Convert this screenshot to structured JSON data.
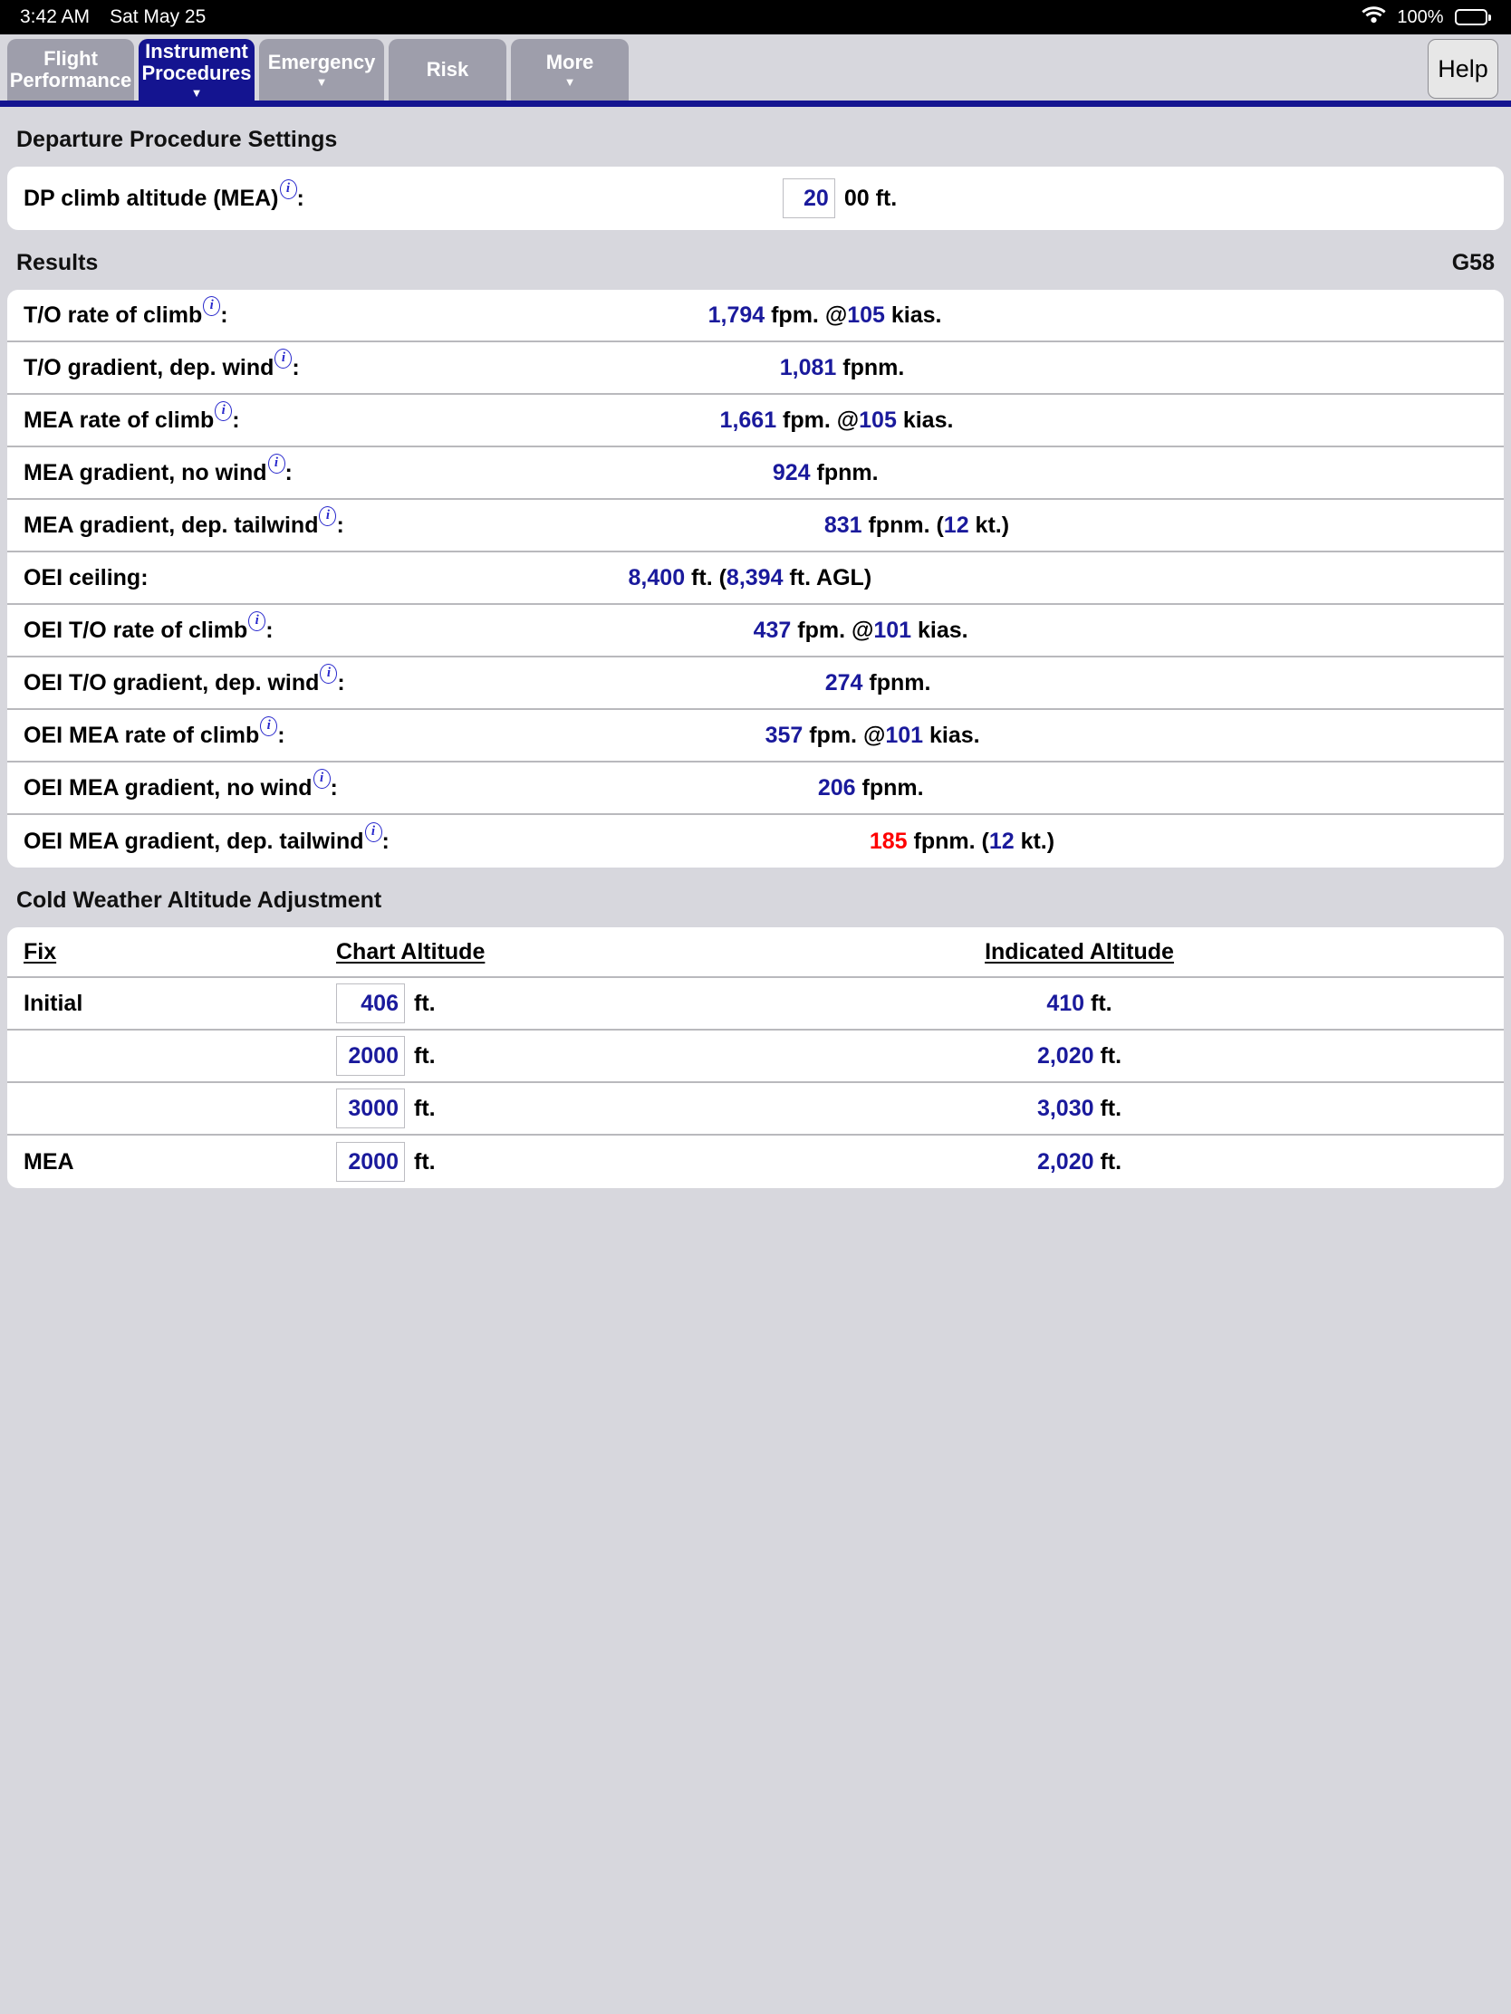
{
  "status_bar": {
    "time": "3:42 AM",
    "date": "Sat May 25",
    "battery_percent": "100%",
    "wifi_icon": "wifi-icon",
    "battery_icon": "battery-full-icon"
  },
  "tabs": [
    {
      "label": "Flight\nPerformance",
      "active": false,
      "has_caret": false,
      "name": "tab-flight-performance"
    },
    {
      "label": "Instrument\nProcedures",
      "active": true,
      "has_caret": true,
      "name": "tab-instrument-procedures"
    },
    {
      "label": "Emergency",
      "active": false,
      "has_caret": true,
      "name": "tab-emergency"
    },
    {
      "label": "Risk",
      "active": false,
      "has_caret": false,
      "name": "tab-risk"
    },
    {
      "label": "More",
      "active": false,
      "has_caret": true,
      "name": "tab-more"
    }
  ],
  "help_button": {
    "label": "Help"
  },
  "departure_settings": {
    "header": "Departure Procedure Settings",
    "dp_climb_altitude": {
      "label": "DP climb altitude (MEA)",
      "colon": ":",
      "value": "20",
      "suffix": "00 ft."
    }
  },
  "results": {
    "header": "Results",
    "aircraft": "G58",
    "rows": [
      {
        "label": "T/O rate of climb",
        "info": true,
        "value": "1,794",
        "unit": " fpm. @",
        "value2": "105",
        "unit2": " kias.",
        "red": false
      },
      {
        "label": "T/O gradient, dep. wind",
        "info": true,
        "value": "1,081",
        "unit": " fpnm.",
        "value2": "",
        "unit2": "",
        "red": false
      },
      {
        "label": "MEA rate of climb",
        "info": true,
        "value": "1,661",
        "unit": " fpm. @",
        "value2": "105",
        "unit2": " kias.",
        "red": false
      },
      {
        "label": "MEA gradient, no wind",
        "info": true,
        "value": "924",
        "unit": " fpnm.",
        "value2": "",
        "unit2": "",
        "red": false
      },
      {
        "label": "MEA gradient, dep. tailwind",
        "info": true,
        "value": "831",
        "unit": " fpnm. (",
        "value2": "12",
        "unit2": " kt.)",
        "red": false
      },
      {
        "label": "OEI ceiling",
        "info": false,
        "value": "8,400",
        "unit": " ft. (",
        "value2": "8,394",
        "unit2": " ft. AGL)",
        "red": false
      },
      {
        "label": "OEI T/O rate of climb",
        "info": true,
        "value": "437",
        "unit": " fpm. @",
        "value2": "101",
        "unit2": " kias.",
        "red": false
      },
      {
        "label": "OEI T/O gradient, dep. wind",
        "info": true,
        "value": "274",
        "unit": " fpnm.",
        "value2": "",
        "unit2": "",
        "red": false
      },
      {
        "label": "OEI MEA rate of climb",
        "info": true,
        "value": "357",
        "unit": " fpm. @",
        "value2": "101",
        "unit2": " kias.",
        "red": false
      },
      {
        "label": "OEI MEA gradient, no wind",
        "info": true,
        "value": "206",
        "unit": " fpnm.",
        "value2": "",
        "unit2": "",
        "red": false
      },
      {
        "label": "OEI MEA gradient, dep. tailwind",
        "info": true,
        "value": "185",
        "unit": " fpnm. (",
        "value2": "12",
        "unit2": " kt.)",
        "red": true
      }
    ]
  },
  "cold_weather": {
    "header": "Cold Weather Altitude Adjustment",
    "columns": [
      "Fix",
      "Chart Altitude",
      "Indicated Altitude"
    ],
    "unit": "ft.",
    "rows": [
      {
        "fix": "Initial",
        "chart_altitude": "406",
        "indicated_altitude": "410 ft."
      },
      {
        "fix": "",
        "chart_altitude": "2000",
        "indicated_altitude": "2,020 ft."
      },
      {
        "fix": "",
        "chart_altitude": "3000",
        "indicated_altitude": "3,030 ft."
      },
      {
        "fix": "MEA",
        "chart_altitude": "2000",
        "indicated_altitude": "2,020 ft."
      }
    ]
  },
  "colors": {
    "accent_blue": "#141490",
    "value_blue": "#1a1a9c",
    "warning_red": "#fe0000",
    "page_bg": "#d7d7dd",
    "tab_inactive": "#9e9eab"
  }
}
